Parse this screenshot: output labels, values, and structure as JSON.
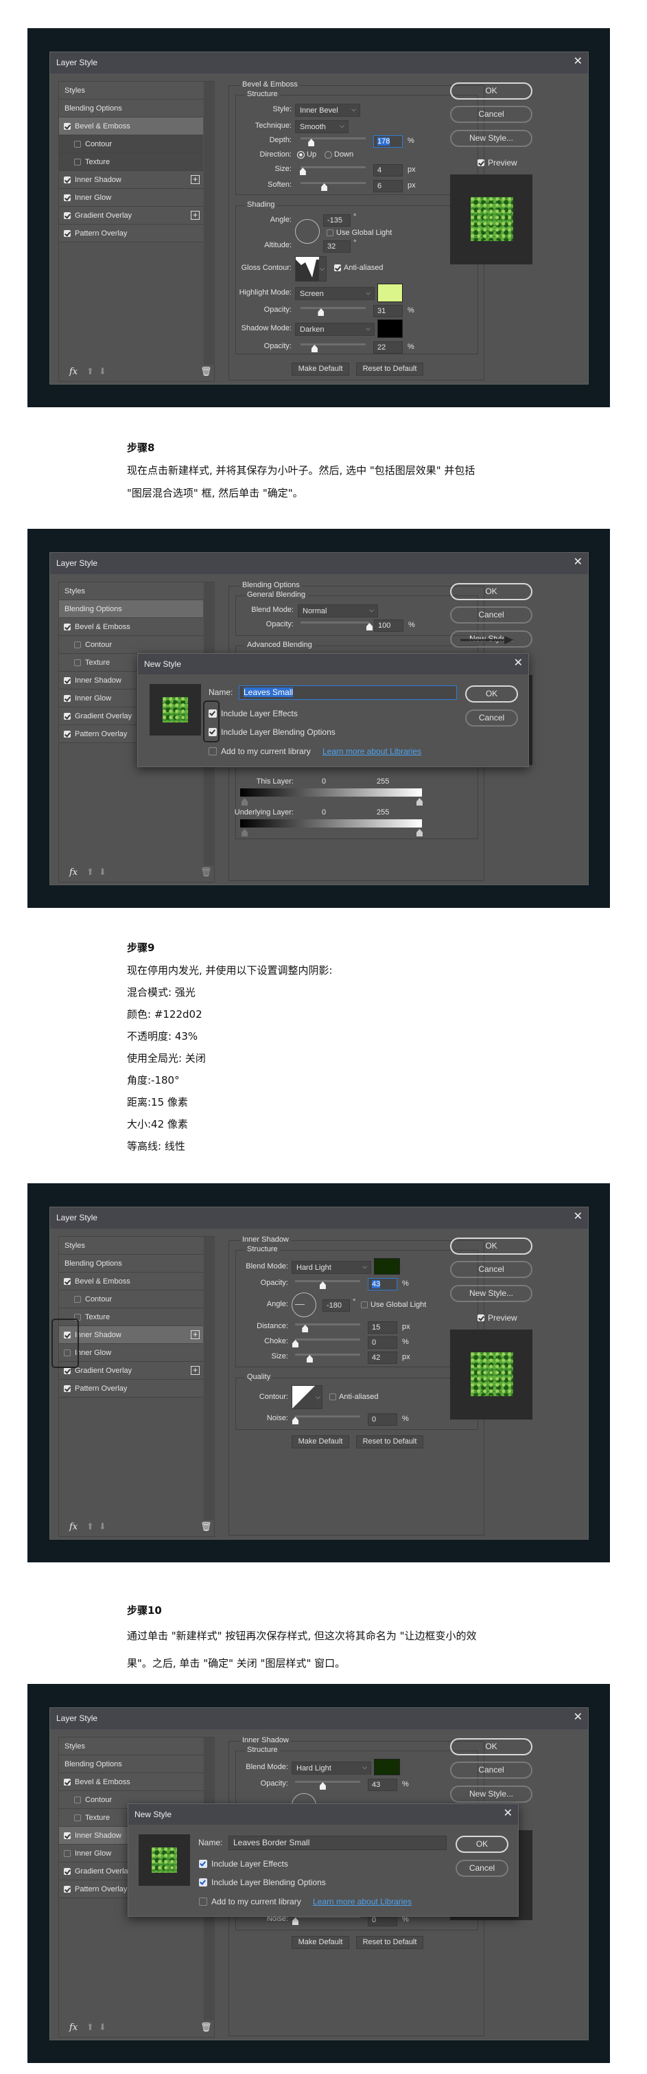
{
  "layer_style": {
    "title": "Layer Style",
    "left_items": [
      "Styles",
      "Blending Options",
      "Bevel & Emboss",
      "Contour",
      "Texture",
      "Inner Shadow",
      "Inner Glow",
      "Gradient Overlay",
      "Pattern Overlay"
    ],
    "ok": "OK",
    "cancel": "Cancel",
    "new_style": "New Style...",
    "preview": "Preview",
    "make_default": "Make Default",
    "reset_default": "Reset to Default",
    "close_icon": "close-icon"
  },
  "shot1": {
    "selected_item": "Bevel & Emboss",
    "checks": {
      "bevel": true,
      "contour": false,
      "texture": false,
      "inner_shadow": true,
      "inner_glow": true,
      "gradient_overlay": true,
      "pattern_overlay": true,
      "preview": true
    },
    "panel": {
      "title": "Bevel & Emboss",
      "structure": "Structure",
      "style_label": "Style:",
      "style_value": "Inner Bevel",
      "technique_label": "Technique:",
      "technique_value": "Smooth",
      "depth_label": "Depth:",
      "depth_value": "178",
      "depth_unit": "%",
      "direction_label": "Direction:",
      "direction_up": "Up",
      "direction_down": "Down",
      "direction_selected": "Up",
      "size_label": "Size:",
      "size_value": "4",
      "size_unit": "px",
      "soften_label": "Soften:",
      "soften_value": "6",
      "soften_unit": "px",
      "shading": "Shading",
      "angle_label": "Angle:",
      "angle_value": "-135",
      "degree": "°",
      "global_light": "Use Global Light",
      "global_light_on": false,
      "altitude_label": "Altitude:",
      "altitude_value": "32",
      "gloss_label": "Gloss Contour:",
      "anti_aliased": "Anti-aliased",
      "anti_aliased_on": true,
      "highlight_label": "Highlight Mode:",
      "highlight_value": "Screen",
      "highlight_color": "#dcf58a",
      "opacity_label": "Opacity:",
      "highlight_opacity": "31",
      "pct": "%",
      "shadow_label": "Shadow Mode:",
      "shadow_value": "Darken",
      "shadow_color": "#000000",
      "shadow_opacity": "22"
    }
  },
  "step8": {
    "title": "步骤8",
    "lines": [
      "现在点击新建样式, 并将其保存为小叶子。然后, 选中 \"包括图层效果\" 并包括",
      "\"图层混合选项\" 框, 然后单击 \"确定\"。"
    ]
  },
  "shot2": {
    "selected_item": "Blending Options",
    "checks": {
      "bevel": true,
      "contour": false,
      "texture": false,
      "inner_shadow": true,
      "inner_glow": true,
      "gradient_overlay": true,
      "pattern_overlay": true
    },
    "panel": {
      "title": "Blending Options",
      "general": "General Blending",
      "blend_label": "Blend Mode:",
      "blend_value": "Normal",
      "opacity_label": "Opacity:",
      "opacity_value": "100",
      "pct": "%",
      "advanced": "Advanced Blending",
      "this_layer": "This Layer:",
      "underlying": "Underlying Layer:",
      "min": "0",
      "max": "255"
    },
    "new_style": {
      "title": "New Style",
      "name_label": "Name:",
      "name_value": "Leaves Small",
      "ok": "OK",
      "cancel": "Cancel",
      "include_effects": "Include Layer Effects",
      "include_effects_on": true,
      "include_blending": "Include Layer Blending Options",
      "include_blending_on": true,
      "add_library": "Add to my current library",
      "add_library_on": false,
      "learn_more": "Learn more about Libraries"
    }
  },
  "step9": {
    "title": "步骤9",
    "lines": [
      "现在停用内发光, 并使用以下设置调整内阴影:",
      "混合模式: 强光",
      "颜色: #122d02",
      "不透明度: 43%",
      "使用全局光: 关闭",
      "角度:-180°",
      "距离:15 像素",
      "大小:42 像素",
      "等高线: 线性"
    ]
  },
  "shot3": {
    "selected_item": "Inner Shadow",
    "checks": {
      "bevel": true,
      "contour": false,
      "texture": false,
      "inner_shadow": true,
      "inner_glow": false,
      "gradient_overlay": true,
      "pattern_overlay": true,
      "preview": true
    },
    "panel": {
      "title": "Inner Shadow",
      "structure": "Structure",
      "blend_label": "Blend Mode:",
      "blend_value": "Hard Light",
      "color": "#122d02",
      "opacity_label": "Opacity:",
      "opacity_value": "43",
      "pct": "%",
      "angle_label": "Angle:",
      "angle_value": "-180",
      "degree": "°",
      "global_light": "Use Global Light",
      "global_light_on": false,
      "distance_label": "Distance:",
      "distance_value": "15",
      "px": "px",
      "choke_label": "Choke:",
      "choke_value": "0",
      "size_label": "Size:",
      "size_value": "42",
      "quality": "Quality",
      "contour_label": "Contour:",
      "anti_aliased": "Anti-aliased",
      "anti_aliased_on": false,
      "noise_label": "Noise:",
      "noise_value": "0"
    }
  },
  "step10": {
    "title": "步骤10",
    "lines": [
      "通过单击 \"新建样式\" 按钮再次保存样式, 但这次将其命名为 \"让边框变小的效",
      "果\"。之后, 单击 \"确定\" 关闭 \"图层样式\" 窗口。"
    ]
  },
  "shot4": {
    "selected_item": "Inner Shadow",
    "checks": {
      "bevel": true,
      "contour": false,
      "texture": false,
      "inner_shadow": true,
      "inner_glow": false,
      "gradient_overlay": true,
      "pattern_overlay": true
    },
    "new_style": {
      "title": "New Style",
      "name_label": "Name:",
      "name_value": "Leaves Border Small",
      "ok": "OK",
      "cancel": "Cancel",
      "include_effects": "Include Layer Effects",
      "include_effects_on": true,
      "include_blending": "Include Layer Blending Options",
      "include_blending_on": true,
      "add_library": "Add to my current library",
      "add_library_on": false,
      "learn_more": "Learn more about Libraries"
    }
  }
}
